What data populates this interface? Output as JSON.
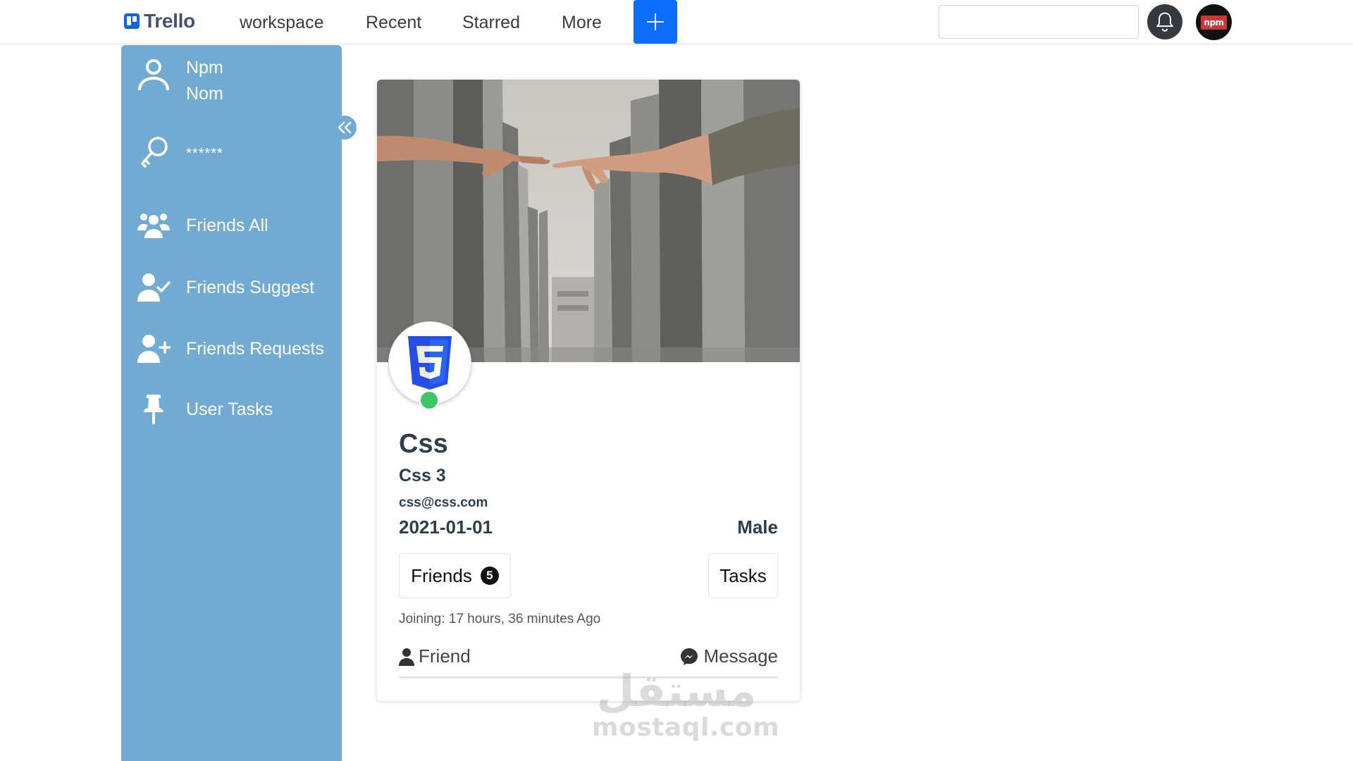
{
  "navbar": {
    "brand": "Trello",
    "links": [
      "workspace",
      "Recent",
      "Starred",
      "More"
    ],
    "search_value": "",
    "icons": {
      "add": "plus-icon",
      "notifications": "bell-icon",
      "avatar": "npm-logo"
    },
    "brand_color": "#0c66e4",
    "add_button_color": "#0d6efd"
  },
  "sidebar": {
    "color": "#71abd4",
    "user": {
      "first_name": "Npm",
      "last_name": "Nom"
    },
    "password_mask": "******",
    "items": [
      {
        "label": "Friends All",
        "icon": "users-icon"
      },
      {
        "label": "Friends Suggest",
        "icon": "user-check-icon"
      },
      {
        "label": "Friends Requests",
        "icon": "user-plus-icon"
      },
      {
        "label": "User Tasks",
        "icon": "pushpin-icon"
      }
    ]
  },
  "profile": {
    "name": "Css",
    "subname": "Css 3",
    "email": "css@css.com",
    "birthdate": "2021-01-01",
    "gender": "Male",
    "friends_label": "Friends",
    "friends_count": "5",
    "tasks_label": "Tasks",
    "joining": "Joining: 17 hours, 36 minutes Ago",
    "friend_action": "Friend",
    "message_action": "Message",
    "status": "online",
    "status_color": "#3ec56a"
  },
  "watermark": {
    "arabic": "مستقل",
    "latin": "mostaql.com"
  }
}
